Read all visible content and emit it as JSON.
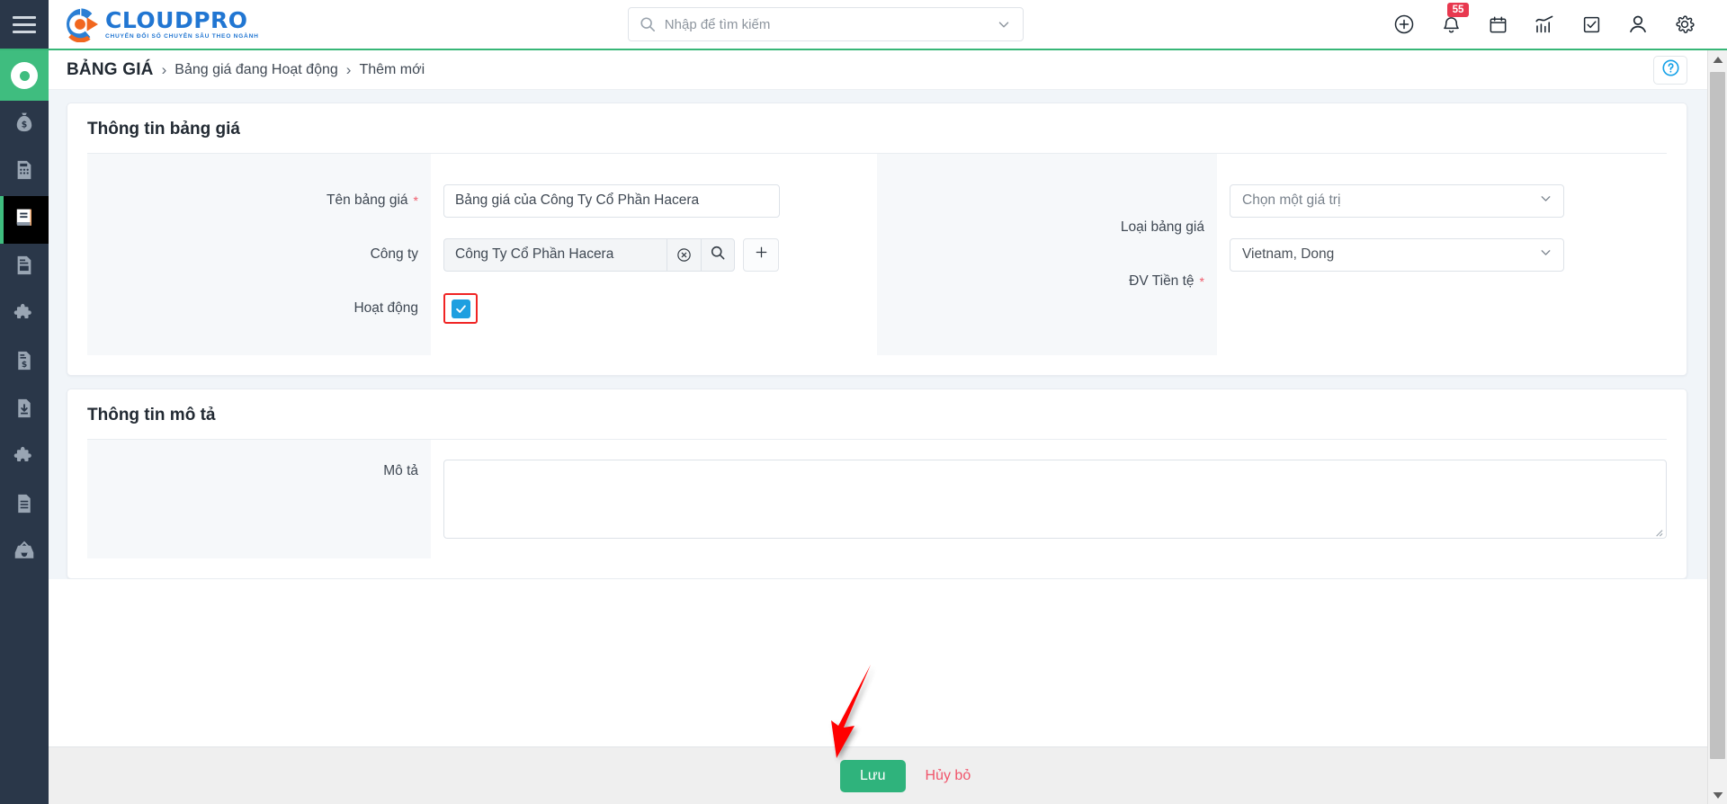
{
  "app": {
    "logo_word": "CLOUDPRO",
    "logo_tagline": "CHUYỂN ĐỔI SỐ CHUYÊN SÂU THEO NGÀNH",
    "accent_green": "#3fbd7f",
    "accent_blue": "#2176d2",
    "accent_orange": "#f1671f",
    "rail_bg": "#2a3749",
    "required_color": "#ef5a6a",
    "danger_color": "#f0556b"
  },
  "search": {
    "placeholder": "Nhập để tìm kiếm",
    "value": "",
    "icon": "search-icon",
    "caret_icon": "chevron-down-icon"
  },
  "header_actions": [
    {
      "name": "add-circle-icon",
      "label": ""
    },
    {
      "name": "bell-icon",
      "label": "",
      "badge": "55"
    },
    {
      "name": "calendar-icon",
      "label": ""
    },
    {
      "name": "analytics-icon",
      "label": ""
    },
    {
      "name": "task-checkbox-icon",
      "label": ""
    },
    {
      "name": "user-icon",
      "label": ""
    },
    {
      "name": "gear-icon",
      "label": ""
    }
  ],
  "sidebar": {
    "menu_icon": "hamburger-icon",
    "brand_icon": "donut-circle-icon",
    "items": [
      {
        "name": "money-bag-icon",
        "active": false
      },
      {
        "name": "calculator-document-icon",
        "active": false
      },
      {
        "name": "price-book-icon",
        "active": true
      },
      {
        "name": "document-card-icon",
        "active": false
      },
      {
        "name": "puzzle-icon",
        "active": false
      },
      {
        "name": "invoice-dollar-icon",
        "active": false
      },
      {
        "name": "document-download-icon",
        "active": false
      },
      {
        "name": "puzzle-alt-icon",
        "active": false
      },
      {
        "name": "document-lines-icon",
        "active": false
      },
      {
        "name": "inbox-archive-icon",
        "active": false
      }
    ]
  },
  "breadcrumb": {
    "root": "BẢNG GIÁ",
    "separator": "›",
    "items": [
      "Bảng giá đang Hoạt động",
      "Thêm mới"
    ],
    "help_icon": "help-circle-icon"
  },
  "sections": [
    {
      "title": "Thông tin bảng giá",
      "left_fields": [
        {
          "label": "Tên bảng giá",
          "required": true,
          "type": "text",
          "value": "Bảng giá của Công Ty Cổ Phần Hacera",
          "placeholder": ""
        },
        {
          "label": "Công ty",
          "required": false,
          "type": "lookup",
          "value": "Công Ty Cổ Phần Hacera",
          "clear_icon": "clear-circle-icon",
          "search_icon": "search-icon",
          "add_icon": "plus-icon"
        },
        {
          "label": "Hoạt động",
          "required": false,
          "type": "checkbox",
          "checked": true,
          "highlighted": true
        }
      ],
      "right_fields": [
        {
          "label": "Loại bảng giá",
          "required": false,
          "type": "select",
          "value": "Chọn một giá trị",
          "is_placeholder": true,
          "caret_icon": "chevron-down-icon"
        },
        {
          "label": "ĐV Tiền tệ",
          "required": true,
          "type": "select",
          "value": "Vietnam, Dong",
          "is_placeholder": false,
          "caret_icon": "chevron-down-icon"
        }
      ]
    },
    {
      "title": "Thông tin mô tả",
      "left_fields": [
        {
          "label": "Mô tả",
          "required": false,
          "type": "textarea",
          "value": "",
          "placeholder": ""
        }
      ],
      "right_fields": []
    }
  ],
  "footer": {
    "save_label": "Lưu",
    "cancel_label": "Hủy bỏ"
  },
  "annotation": {
    "arrow_color": "#ff0000",
    "points_to": "save-button"
  },
  "scrollbar": {
    "up_icon": "caret-up-icon",
    "down_icon": "caret-down-icon"
  }
}
